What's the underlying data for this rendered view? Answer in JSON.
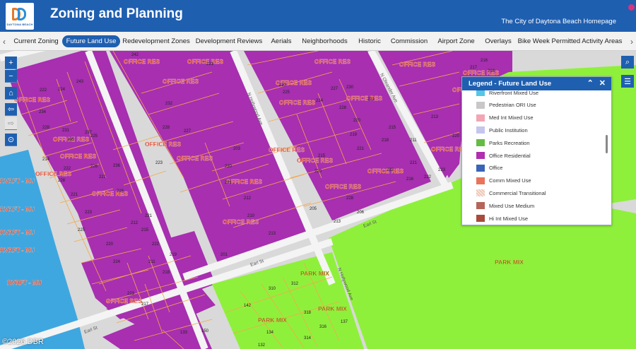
{
  "header": {
    "logo_text": "DAYTONA BEACH",
    "title": "Zoning and Planning",
    "home_link": "The City of Daytona Beach Homepage"
  },
  "tabs": [
    {
      "label": "Current Zoning"
    },
    {
      "label": "Future Land Use",
      "active": true
    },
    {
      "label": "Redevelopment Zones"
    },
    {
      "label": "Development Reviews"
    },
    {
      "label": "Aerials"
    },
    {
      "label": "Neighborhoods"
    },
    {
      "label": "Historic"
    },
    {
      "label": "Commission"
    },
    {
      "label": "Airport Zone"
    },
    {
      "label": "Overlays"
    },
    {
      "label": "Bike Week Permitted Activity Areas"
    }
  ],
  "map_controls": {
    "zoom_in": "+",
    "zoom_out": "−",
    "home_icon": "home-icon",
    "back_icon": "arrow-left-icon",
    "forward_icon": "arrow-right-icon",
    "locate_icon": "locate-icon",
    "search_icon": "search-icon",
    "legend_icon": "list-icon"
  },
  "legend": {
    "title": "Legend - Future Land Use",
    "items": [
      {
        "label": "Riverfront Mixed Use",
        "color": "#54c6e6"
      },
      {
        "label": "Pedestrian ORI Use",
        "color": "#c8c8c8"
      },
      {
        "label": "Med Int Mixed Use",
        "color": "#f2a6b4"
      },
      {
        "label": "Public Institution",
        "color": "#c5c5ee"
      },
      {
        "label": "Parks Recreation",
        "color": "#66bb44"
      },
      {
        "label": "Office Residential",
        "color": "#b02eb0"
      },
      {
        "label": "Office",
        "color": "#3a64b8"
      },
      {
        "label": "Comm Mixed Use",
        "color": "#e8735a"
      },
      {
        "label": "Commercial Transitional",
        "color": "#f3d9cf"
      },
      {
        "label": "Mixed Use Medium",
        "color": "#b6655a"
      },
      {
        "label": "Hi Int Mixed Use",
        "color": "#a84a3c"
      }
    ]
  },
  "map_labels": {
    "zones": [
      "OFFICE RES",
      "OFFICE RES",
      "OFFICE RES",
      "OFFICE RES",
      "OFFICE RES",
      "OFFICE RES",
      "OFFICE RES",
      "OFFICE RES",
      "OFFICE RES",
      "OFFICE RES",
      "OFFICE RES",
      "OFFICE RES",
      "OFFICE RES",
      "OFFICE RES",
      "OFFICE RES",
      "OFFICE RES",
      "OFFICE RES",
      "OFFICE RES",
      "OFFICE RES",
      "OFFICE RES",
      "OFFICE RES",
      "OFFICE RES",
      "OFFICE RES",
      "OFFICE RES",
      "OFFICE RES",
      "PARK MIX",
      "PARK MIX",
      "PARK MIX",
      "PARK MIX",
      "RVRFT - MU",
      "RVRFT - MU",
      "RVRFT - MU",
      "RVRFT - MU",
      "RVRFT - MU"
    ],
    "streets": [
      "N Hollywood Ave",
      "N Oleander Ave",
      "Earl St",
      "Earl St",
      "Earl St",
      "N Hollywood Ave"
    ],
    "parcels": [
      "242",
      "221",
      "222",
      "224",
      "243",
      "234",
      "232",
      "228",
      "231",
      "237",
      "235",
      "236",
      "226",
      "225",
      "228",
      "227",
      "222",
      "221",
      "223",
      "214",
      "228",
      "221",
      "223",
      "225",
      "220",
      "215",
      "216",
      "212",
      "221",
      "222",
      "224",
      "223",
      "217",
      "218",
      "219",
      "211",
      "201",
      "213",
      "210",
      "212",
      "220",
      "221",
      "203",
      "223",
      "225",
      "224",
      "227",
      "230",
      "231",
      "228",
      "220",
      "219",
      "218",
      "223",
      "216",
      "215",
      "220",
      "221",
      "205",
      "228",
      "206",
      "213",
      "215",
      "211",
      "213",
      "214",
      "217",
      "216",
      "218",
      "220",
      "221",
      "222",
      "223",
      "310",
      "312",
      "318",
      "316",
      "314",
      "142",
      "134",
      "137",
      "132",
      "133",
      "150"
    ]
  },
  "copyright": "©2026 DBR"
}
